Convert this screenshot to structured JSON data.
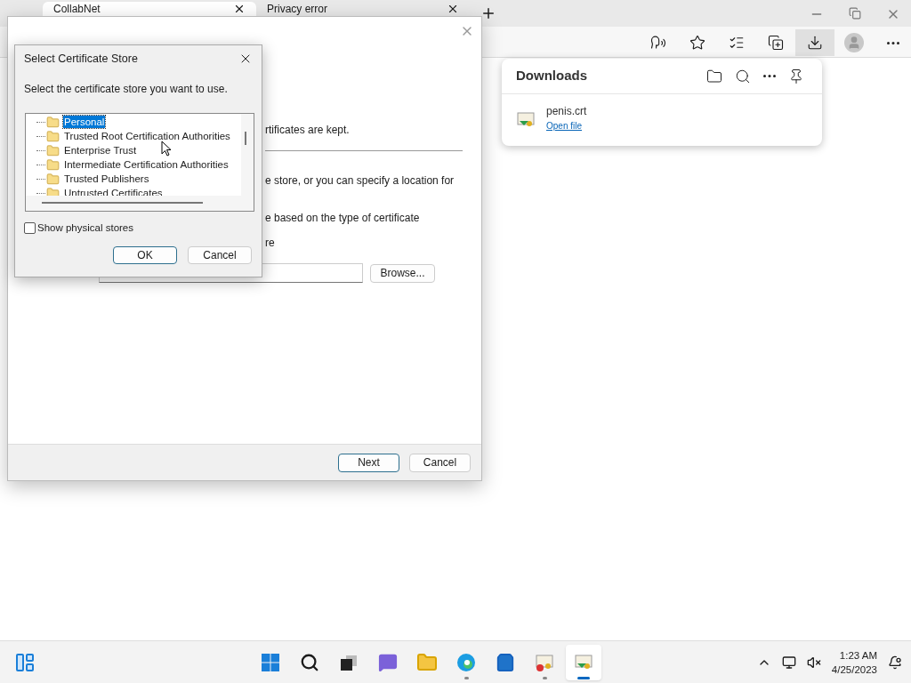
{
  "browser": {
    "tabs": [
      {
        "title": "CollabNet",
        "selected": true
      },
      {
        "title": "Privacy error",
        "selected": false
      }
    ],
    "toolbar": [
      {
        "kind": "read_aloud",
        "selected": false
      },
      {
        "kind": "add_favorite",
        "selected": false
      },
      {
        "kind": "favorites",
        "selected": false
      },
      {
        "kind": "collections",
        "selected": false
      },
      {
        "kind": "downloads",
        "selected": true
      },
      {
        "kind": "profile",
        "selected": false
      },
      {
        "kind": "more",
        "selected": false
      }
    ]
  },
  "downloads": {
    "title": "Downloads",
    "items": [
      {
        "name": "penis.crt",
        "action": "Open file"
      }
    ]
  },
  "wizard": {
    "fragments": [
      "rtificates are kept.",
      "e store, or you can specify a location for",
      "e based on the type of certificate",
      "re"
    ],
    "browse": "Browse...",
    "buttons": [
      {
        "label": "Next",
        "default": true
      },
      {
        "label": "Cancel",
        "default": false
      }
    ]
  },
  "dialog": {
    "title": "Select Certificate Store",
    "prompt": "Select the certificate store you want to use.",
    "stores": [
      {
        "label": "Personal",
        "selected": true
      },
      {
        "label": "Trusted Root Certification Authorities",
        "selected": false
      },
      {
        "label": "Enterprise Trust",
        "selected": false
      },
      {
        "label": "Intermediate Certification Authorities",
        "selected": false
      },
      {
        "label": "Trusted Publishers",
        "selected": false
      },
      {
        "label": "Untrusted Certificates",
        "selected": false
      }
    ],
    "show_physical_stores": {
      "label": "Show physical stores",
      "checked": false
    },
    "buttons": [
      {
        "label": "OK",
        "default": true
      },
      {
        "label": "Cancel",
        "default": false
      }
    ]
  },
  "taskbar": {
    "apps": [
      {
        "kind": "start",
        "running": false,
        "active": false
      },
      {
        "kind": "search",
        "running": false,
        "active": false
      },
      {
        "kind": "task_view",
        "running": false,
        "active": false
      },
      {
        "kind": "chat",
        "running": false,
        "active": false
      },
      {
        "kind": "explorer",
        "running": false,
        "active": false
      },
      {
        "kind": "edge",
        "running": true,
        "active": false
      },
      {
        "kind": "store",
        "running": false,
        "active": false
      },
      {
        "kind": "cert_error",
        "running": true,
        "active": false
      },
      {
        "kind": "cert_import",
        "running": true,
        "active": true
      }
    ],
    "clock": {
      "time": "1:23 AM",
      "date": "4/25/2023"
    }
  }
}
